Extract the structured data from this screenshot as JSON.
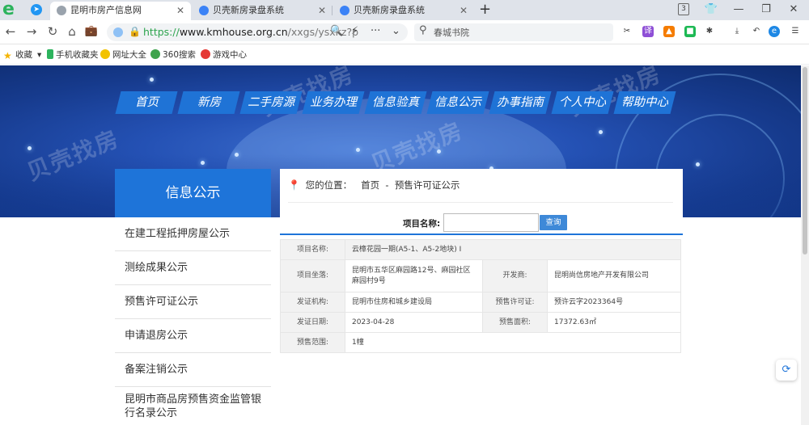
{
  "browser": {
    "tabs": [
      {
        "title": "昆明市房产信息网",
        "active": true
      },
      {
        "title": "贝壳新房录盘系统",
        "active": false
      },
      {
        "title": "贝壳新房录盘系统",
        "active": false
      }
    ],
    "tab_count": "3",
    "url_scheme": "https://",
    "url_domain": "www.kmhouse.org.cn",
    "url_path": "/xxgs/ysxkz?p",
    "search_query": "春城书院",
    "bookmarks": [
      "收藏",
      "手机收藏夹",
      "网址大全",
      "360搜索",
      "游戏中心"
    ],
    "icons": {
      "back": "arrow-left-icon",
      "forward": "arrow-right-icon",
      "reload": "reload-icon",
      "home": "home-icon",
      "extensions": "puzzle-icon",
      "download": "download-icon",
      "undo": "undo-icon",
      "menu": "hamburger-icon"
    }
  },
  "site": {
    "nav": [
      "首页",
      "新房",
      "二手房源",
      "业务办理",
      "信息验真",
      "信息公示",
      "办事指南",
      "个人中心",
      "帮助中心"
    ],
    "watermark": "贝壳找房",
    "sidebar_title": "信息公示",
    "sidebar_items": [
      "在建工程抵押房屋公示",
      "测绘成果公示",
      "预售许可证公示",
      "申请退房公示",
      "备案注销公示",
      "昆明市商品房预售资金监管银行名录公示"
    ],
    "location_label": "您的位置：",
    "breadcrumb": [
      "首页",
      "-",
      "预售许可证公示"
    ],
    "search_label": "项目名称:",
    "search_value": "",
    "search_button": "查询",
    "details": [
      {
        "label": "项目名称:",
        "value": "云樟花园一期(A5-1、A5-2地块) I"
      },
      {
        "label": "项目坐落:",
        "value": "昆明市五华区麻园路12号、麻园社区麻园村9号",
        "label2": "开发商:",
        "value2": "昆明尚信房地产开发有限公司"
      },
      {
        "label": "发证机构:",
        "value": "昆明市住房和城乡建设局",
        "label2": "预售许可证:",
        "value2": "预许云字2023364号"
      },
      {
        "label": "发证日期:",
        "value": "2023-04-28",
        "label2": "预售面积:",
        "value2": "17372.63㎡"
      },
      {
        "label": "预售范围:",
        "value": "1幢"
      }
    ]
  },
  "colors": {
    "accent": "#1e74d9",
    "nav_bg": "#1f73d6",
    "banner": "#2451b4",
    "url_lock": "#2da44e"
  }
}
